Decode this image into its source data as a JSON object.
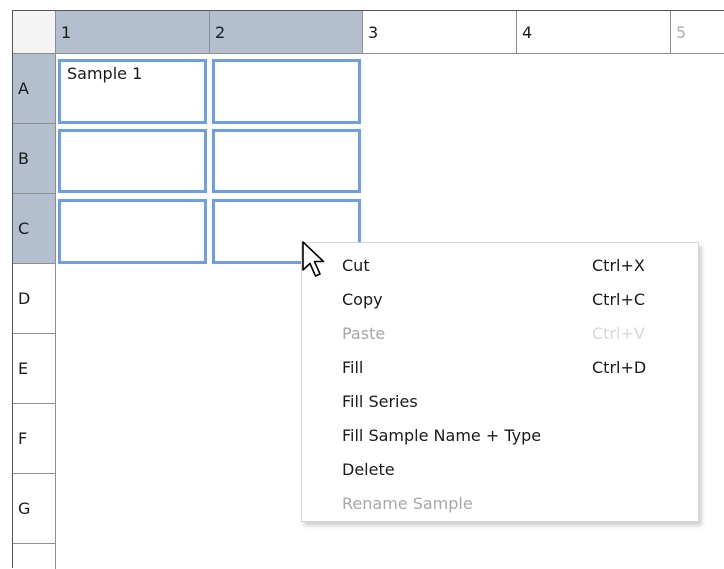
{
  "columns": [
    "1",
    "2",
    "3",
    "4",
    "5"
  ],
  "rows": [
    "A",
    "B",
    "C",
    "D",
    "E",
    "F",
    "G"
  ],
  "cells": {
    "a1": "Sample 1",
    "a2": "",
    "b1": "",
    "b2": "",
    "c1": "",
    "c2": ""
  },
  "context_menu": {
    "items": [
      {
        "label": "Cut",
        "shortcut": "Ctrl+X",
        "enabled": true
      },
      {
        "label": "Copy",
        "shortcut": "Ctrl+C",
        "enabled": true
      },
      {
        "label": "Paste",
        "shortcut": "Ctrl+V",
        "enabled": false
      },
      {
        "label": "Fill",
        "shortcut": "Ctrl+D",
        "enabled": true
      },
      {
        "label": "Fill Series",
        "shortcut": "",
        "enabled": true
      },
      {
        "label": "Fill Sample Name + Type",
        "shortcut": "",
        "enabled": true
      },
      {
        "label": "Delete",
        "shortcut": "",
        "enabled": true
      },
      {
        "label": "Rename Sample",
        "shortcut": "",
        "enabled": false
      }
    ]
  },
  "colors": {
    "selection_border": "#6d9eea",
    "header_selected": "#b3bfcf",
    "disabled_text": "#a8a8a8"
  }
}
